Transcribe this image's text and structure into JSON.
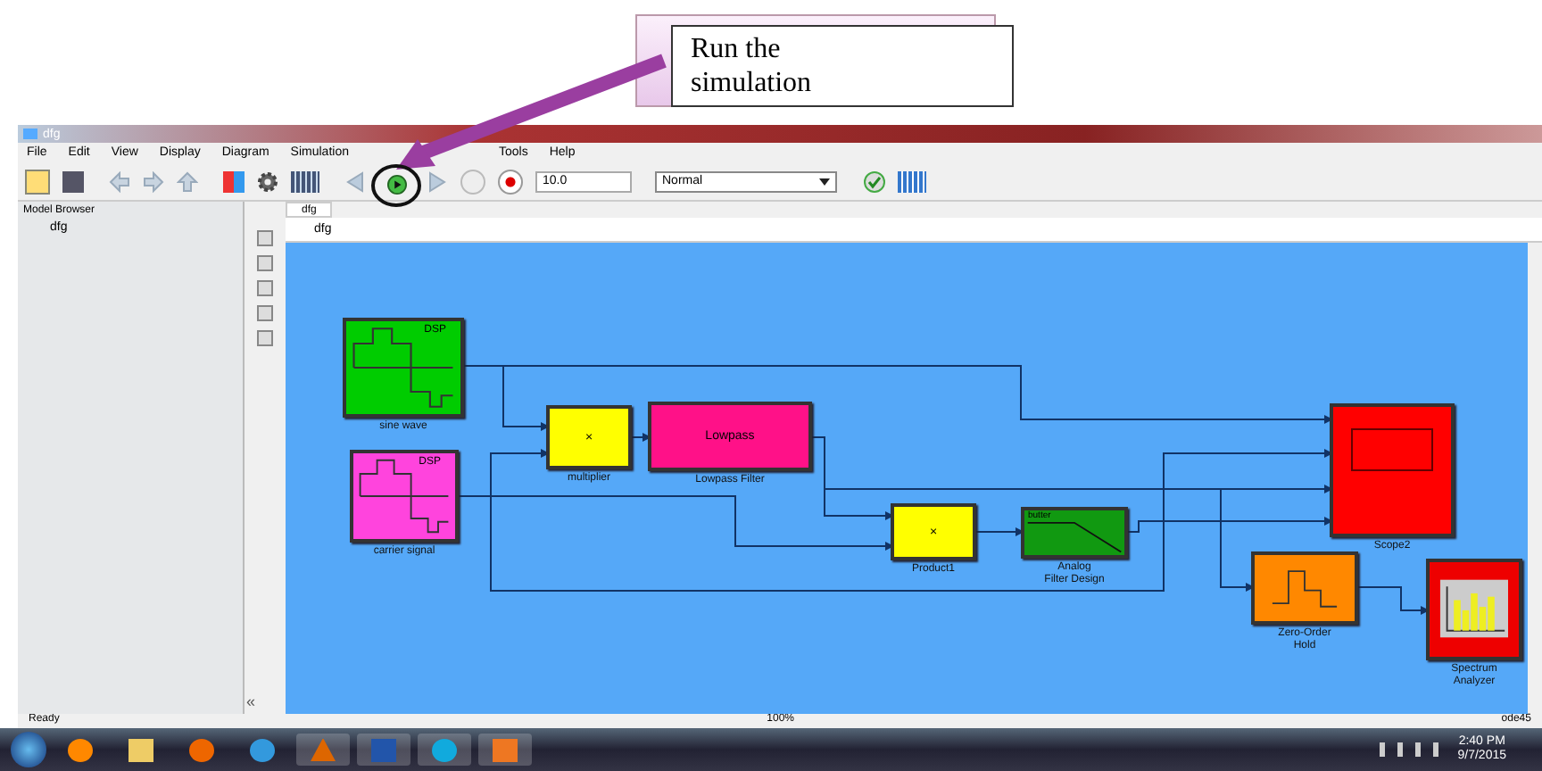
{
  "annotation": {
    "text": "Run the simulation"
  },
  "window": {
    "title": "dfg"
  },
  "menu": [
    "File",
    "Edit",
    "View",
    "Display",
    "Diagram",
    "Simulation"
  ],
  "menu_right": [
    "Tools",
    "Help"
  ],
  "toolbar": {
    "stop_time": "10.0",
    "mode": "Normal"
  },
  "model_browser": {
    "title": "Model Browser",
    "items": [
      {
        "label": "dfg",
        "selected": false
      }
    ],
    "collapse": "«"
  },
  "tabs": [
    {
      "label": "dfg",
      "selected": true
    }
  ],
  "breadcrumb": "dfg",
  "blocks": [
    {
      "kind": "source",
      "label": [
        "sine wave"
      ],
      "text": "DSP",
      "color": "#00cc00"
    },
    {
      "kind": "source",
      "label": [
        "carrier signal"
      ],
      "text": "DSP",
      "color": "#ff44dd"
    },
    {
      "kind": "product",
      "label": [
        "multiplier"
      ],
      "text": "×",
      "color": "#ffff00"
    },
    {
      "kind": "filter",
      "label": [
        "Lowpass Filter"
      ],
      "text": "Lowpass",
      "color": "#ff1188"
    },
    {
      "kind": "product",
      "label": [
        "Product1"
      ],
      "text": "×",
      "color": "#ffff00"
    },
    {
      "kind": "analog",
      "label": [
        "Analog",
        "Filter Design"
      ],
      "text": "butter",
      "color": "#119911"
    },
    {
      "kind": "scope",
      "label": [
        "Scope2"
      ],
      "color": "#ff0000"
    },
    {
      "kind": "zoh",
      "label": [
        "Zero-Order",
        "Hold"
      ],
      "color": "#ff8800"
    },
    {
      "kind": "spectrum",
      "label": [
        "Spectrum",
        "Analyzer"
      ],
      "color": "#ee0000"
    }
  ],
  "status_bar": {
    "left": "Ready",
    "center": "100%",
    "right": "ode45"
  },
  "taskbar": {
    "time": "2:40 PM",
    "date": "9/7/2015"
  }
}
